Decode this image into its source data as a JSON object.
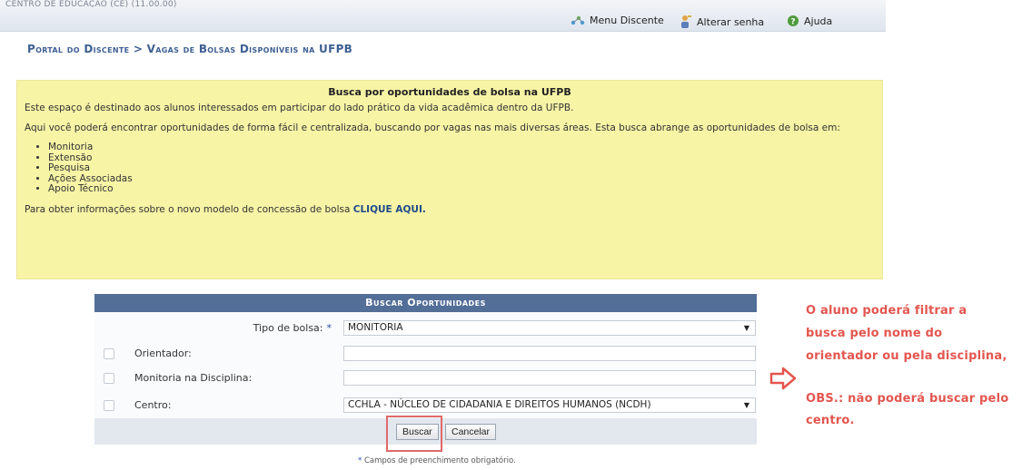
{
  "header": {
    "center_text": "CENTRO DE EDUCAÇÃO (CE) (11.00.00)",
    "links": [
      {
        "label": "Menu Discente",
        "icon": "menu-icon"
      },
      {
        "label": "Alterar senha",
        "icon": "user-key-icon"
      },
      {
        "label": "Ajuda",
        "icon": "help-icon"
      }
    ]
  },
  "breadcrumb": "Portal do Discente > Vagas de Bolsas Disponíveis na UFPB",
  "info": {
    "title": "Busca por oportunidades de bolsa na UFPB",
    "p1": "Este espaço é destinado aos alunos interessados em participar do lado prático da vida acadêmica dentro da UFPB.",
    "p2": "Aqui você poderá encontrar oportunidades de forma fácil e centralizada, buscando por vagas nas mais diversas áreas. Esta busca abrange as oportunidades de bolsa em:",
    "items": [
      "Monitoria",
      "Extensão",
      "Pesquisa",
      "Ações Associadas",
      "Apoio Técnico"
    ],
    "p3": "Para obter informações sobre o novo modelo de concessão de bolsa",
    "link": "CLIQUE AQUI."
  },
  "form": {
    "title": "Buscar Oportunidades",
    "tipo_label": "Tipo de bolsa:",
    "tipo_value": "MONITORIA",
    "orientador_label": "Orientador:",
    "orientador_value": "",
    "disciplina_label": "Monitoria na Disciplina:",
    "disciplina_value": "",
    "centro_label": "Centro:",
    "centro_value": "CCHLA - NÚCLEO DE CIDADANIA E DIREITOS HUMANOS (NCDH)",
    "buscar": "Buscar",
    "cancelar": "Cancelar",
    "required_mark": "*",
    "note": "Campos de preenchimento obrigatório."
  },
  "annotation": {
    "line1": "O aluno poderá filtrar a",
    "line2": "busca pelo nome do",
    "line3": "orientador ou pela disciplina,",
    "line4": "OBS.: não poderá buscar pelo",
    "line5": "centro.",
    "color": "#e3564f"
  },
  "colors": {
    "accent": "#536e97",
    "info_bg": "#f7f4a6",
    "link": "#1f4a8a"
  }
}
